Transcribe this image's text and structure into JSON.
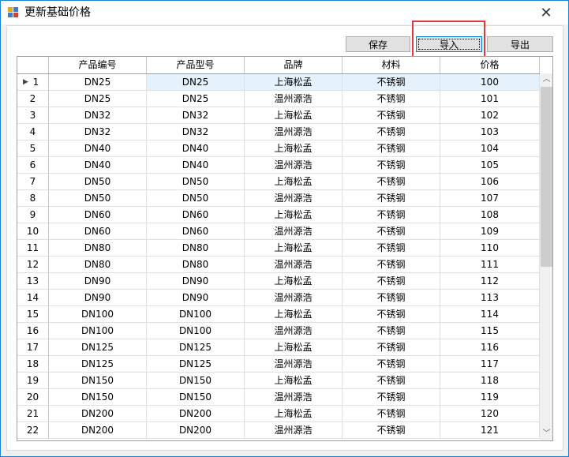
{
  "window": {
    "title": "更新基础价格",
    "close_label": "✕"
  },
  "toolbar": {
    "save_label": "保存",
    "import_label": "导入",
    "export_label": "导出"
  },
  "grid": {
    "columns": [
      "产品编号",
      "产品型号",
      "品牌",
      "材料",
      "价格"
    ],
    "current_row_index": 0,
    "rows": [
      {
        "no": "1",
        "code": "DN25",
        "model": "DN25",
        "brand": "上海松孟",
        "material": "不锈钢",
        "price": "100"
      },
      {
        "no": "2",
        "code": "DN25",
        "model": "DN25",
        "brand": "温州源浩",
        "material": "不锈钢",
        "price": "101"
      },
      {
        "no": "3",
        "code": "DN32",
        "model": "DN32",
        "brand": "上海松孟",
        "material": "不锈钢",
        "price": "102"
      },
      {
        "no": "4",
        "code": "DN32",
        "model": "DN32",
        "brand": "温州源浩",
        "material": "不锈钢",
        "price": "103"
      },
      {
        "no": "5",
        "code": "DN40",
        "model": "DN40",
        "brand": "上海松孟",
        "material": "不锈钢",
        "price": "104"
      },
      {
        "no": "6",
        "code": "DN40",
        "model": "DN40",
        "brand": "温州源浩",
        "material": "不锈钢",
        "price": "105"
      },
      {
        "no": "7",
        "code": "DN50",
        "model": "DN50",
        "brand": "上海松孟",
        "material": "不锈钢",
        "price": "106"
      },
      {
        "no": "8",
        "code": "DN50",
        "model": "DN50",
        "brand": "温州源浩",
        "material": "不锈钢",
        "price": "107"
      },
      {
        "no": "9",
        "code": "DN60",
        "model": "DN60",
        "brand": "上海松孟",
        "material": "不锈钢",
        "price": "108"
      },
      {
        "no": "10",
        "code": "DN60",
        "model": "DN60",
        "brand": "温州源浩",
        "material": "不锈钢",
        "price": "109"
      },
      {
        "no": "11",
        "code": "DN80",
        "model": "DN80",
        "brand": "上海松孟",
        "material": "不锈钢",
        "price": "110"
      },
      {
        "no": "12",
        "code": "DN80",
        "model": "DN80",
        "brand": "温州源浩",
        "material": "不锈钢",
        "price": "111"
      },
      {
        "no": "13",
        "code": "DN90",
        "model": "DN90",
        "brand": "上海松孟",
        "material": "不锈钢",
        "price": "112"
      },
      {
        "no": "14",
        "code": "DN90",
        "model": "DN90",
        "brand": "温州源浩",
        "material": "不锈钢",
        "price": "113"
      },
      {
        "no": "15",
        "code": "DN100",
        "model": "DN100",
        "brand": "上海松孟",
        "material": "不锈钢",
        "price": "114"
      },
      {
        "no": "16",
        "code": "DN100",
        "model": "DN100",
        "brand": "温州源浩",
        "material": "不锈钢",
        "price": "115"
      },
      {
        "no": "17",
        "code": "DN125",
        "model": "DN125",
        "brand": "上海松孟",
        "material": "不锈钢",
        "price": "116"
      },
      {
        "no": "18",
        "code": "DN125",
        "model": "DN125",
        "brand": "温州源浩",
        "material": "不锈钢",
        "price": "117"
      },
      {
        "no": "19",
        "code": "DN150",
        "model": "DN150",
        "brand": "上海松孟",
        "material": "不锈钢",
        "price": "118"
      },
      {
        "no": "20",
        "code": "DN150",
        "model": "DN150",
        "brand": "温州源浩",
        "material": "不锈钢",
        "price": "119"
      },
      {
        "no": "21",
        "code": "DN200",
        "model": "DN200",
        "brand": "上海松孟",
        "material": "不锈钢",
        "price": "120"
      },
      {
        "no": "22",
        "code": "DN200",
        "model": "DN200",
        "brand": "温州源浩",
        "material": "不锈钢",
        "price": "121"
      }
    ]
  },
  "icons": {
    "app": "app-grid-icon",
    "close": "close-icon",
    "current_row": "caret-right-icon",
    "scroll_up": "chevron-up-icon",
    "scroll_down": "chevron-down-icon"
  },
  "colors": {
    "selection": "#e5f1fb",
    "focus_border": "#0078d7",
    "annotation": "#e03a3a",
    "window_border": "#1883d7"
  }
}
